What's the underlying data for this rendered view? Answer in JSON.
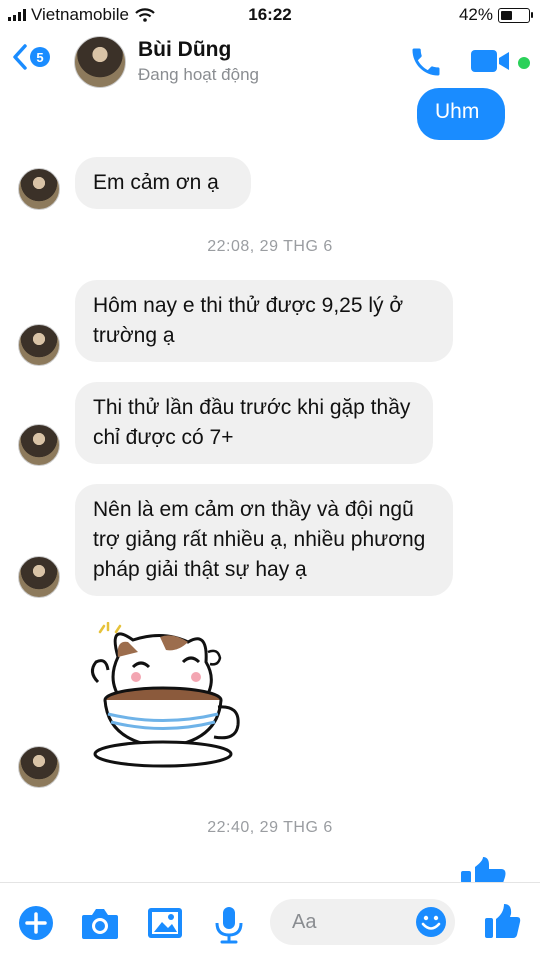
{
  "status_bar": {
    "carrier": "Vietnamobile",
    "time": "16:22",
    "battery": "42%"
  },
  "header": {
    "back_count": "5",
    "name": "Bùi Dũng",
    "status": "Đang hoạt động"
  },
  "messages": {
    "out_1": "Uhm",
    "in_1": "Em cảm ơn ạ",
    "ts_1": "22:08, 29 THG 6",
    "in_2": "Hôm nay e thi thử được 9,25 lý ở trường ạ",
    "in_3": "Thi thử lần đầu trước khi gặp thầy chỉ được có 7+",
    "in_4": "Nên là em cảm ơn thầy và đội ngũ trợ giảng rất nhiều ạ, nhiều phương pháp giải thật sự hay ạ",
    "ts_2": "22:40, 29 THG 6"
  },
  "composer": {
    "placeholder": "Aa"
  },
  "colors": {
    "accent": "#1a8cff",
    "bubble_in": "#f0f0f0",
    "online": "#2bd15a"
  },
  "icons": [
    "back-chevron-icon",
    "phone-icon",
    "video-camera-icon",
    "plus-icon",
    "camera-icon",
    "image-icon",
    "microphone-icon",
    "emoji-icon",
    "thumbs-up-icon"
  ]
}
